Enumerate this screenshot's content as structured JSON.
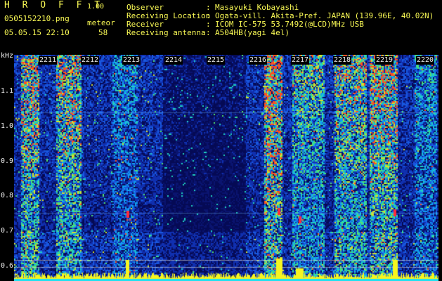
{
  "header": {
    "app_title": "H R O F F T",
    "version": "1.00",
    "file_name": "0505152210.png",
    "timestamp": "05.05.15 22:10",
    "count_label": "meteor",
    "count_value": "58"
  },
  "info": [
    {
      "key": "Observer",
      "value": "Masayuki Kobayashi"
    },
    {
      "key": "Receiving Location",
      "value": "Ogata-vill. Akita-Pref. JAPAN (139.96E, 40.02N)"
    },
    {
      "key": "Receiver",
      "value": "ICOM IC-575 53.7492(@LCD)MHz USB"
    },
    {
      "key": "Receiving antenna",
      "value": "A504HB(yagi 4el)"
    }
  ],
  "separator": ":",
  "axis": {
    "y_unit": "kHz",
    "y_ticks": [
      "1.1",
      "1.0",
      "0.9",
      "0.8",
      "0.7",
      "0.6"
    ],
    "x_ticks": [
      "2211",
      "2212",
      "2213",
      "2214",
      "2215",
      "2216",
      "2217",
      "2218",
      "2219",
      "2220"
    ]
  },
  "colors": {
    "background": "#000000",
    "header_text": "#fafa55",
    "axis_text": "#f0f0f0",
    "noise_floor": "#0a1a8c",
    "signal_peak": "#ff3030",
    "baseline": "#ffff30"
  }
}
